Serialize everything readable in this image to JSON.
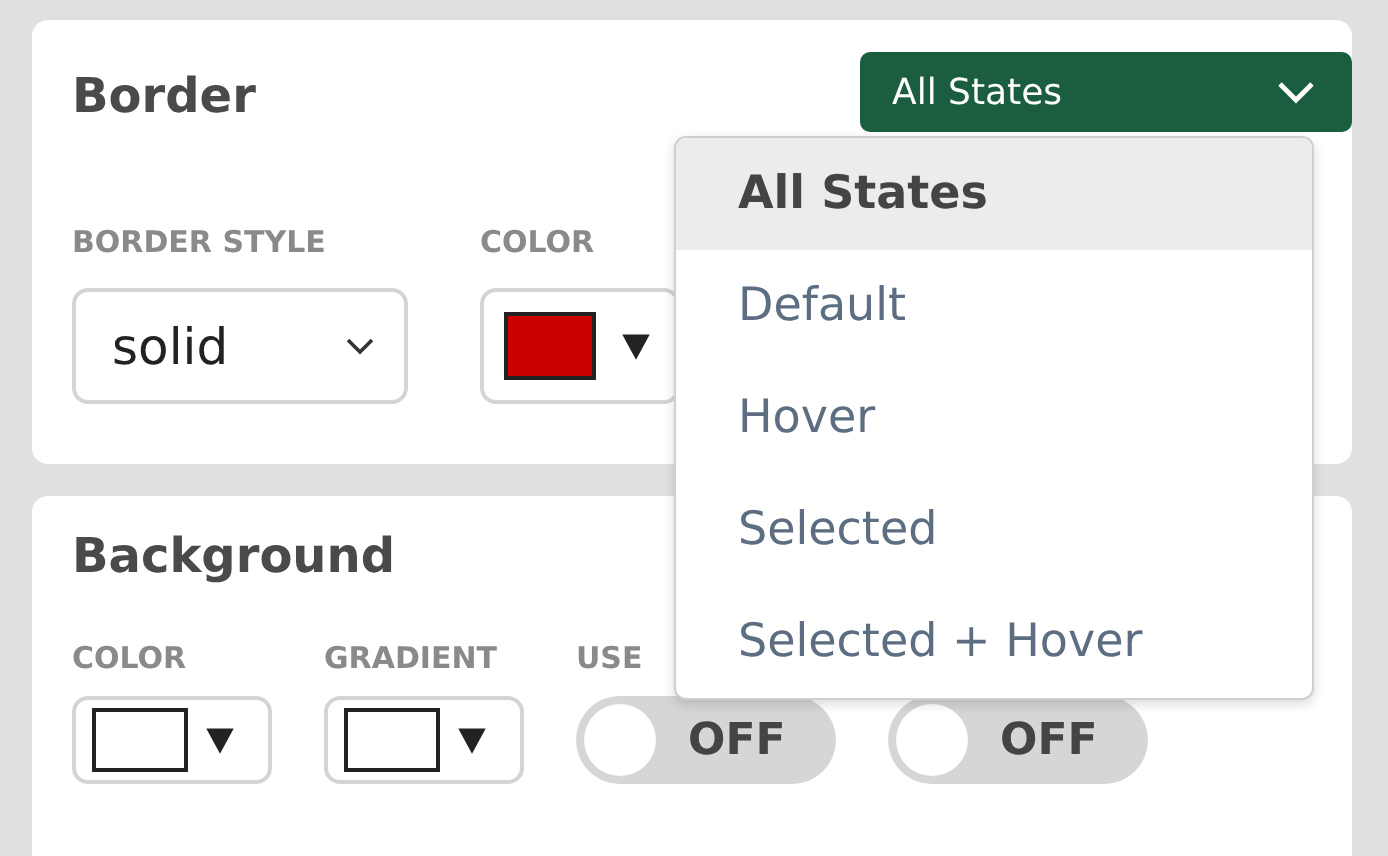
{
  "border": {
    "title": "Border",
    "state_button": {
      "label": "All States"
    },
    "fields": [
      {
        "kind": "select",
        "label": "BORDER STYLE",
        "value": "solid"
      },
      {
        "kind": "color",
        "label": "COLOR",
        "color": "#cc0000"
      }
    ]
  },
  "state_menu": [
    {
      "label": "All States",
      "selected": true
    },
    {
      "label": "Default",
      "selected": false
    },
    {
      "label": "Hover",
      "selected": false
    },
    {
      "label": "Selected",
      "selected": false
    },
    {
      "label": "Selected + Hover",
      "selected": false
    }
  ],
  "background": {
    "title": "Background",
    "fields": [
      {
        "kind": "color",
        "label": "COLOR",
        "color": "#ffffff"
      },
      {
        "kind": "color",
        "label": "GRADIENT",
        "color": "#ffffff"
      },
      {
        "kind": "toggle",
        "label": "USE",
        "on": false,
        "text": "OFF"
      },
      {
        "kind": "toggle",
        "on": false,
        "text": "OFF"
      }
    ]
  }
}
